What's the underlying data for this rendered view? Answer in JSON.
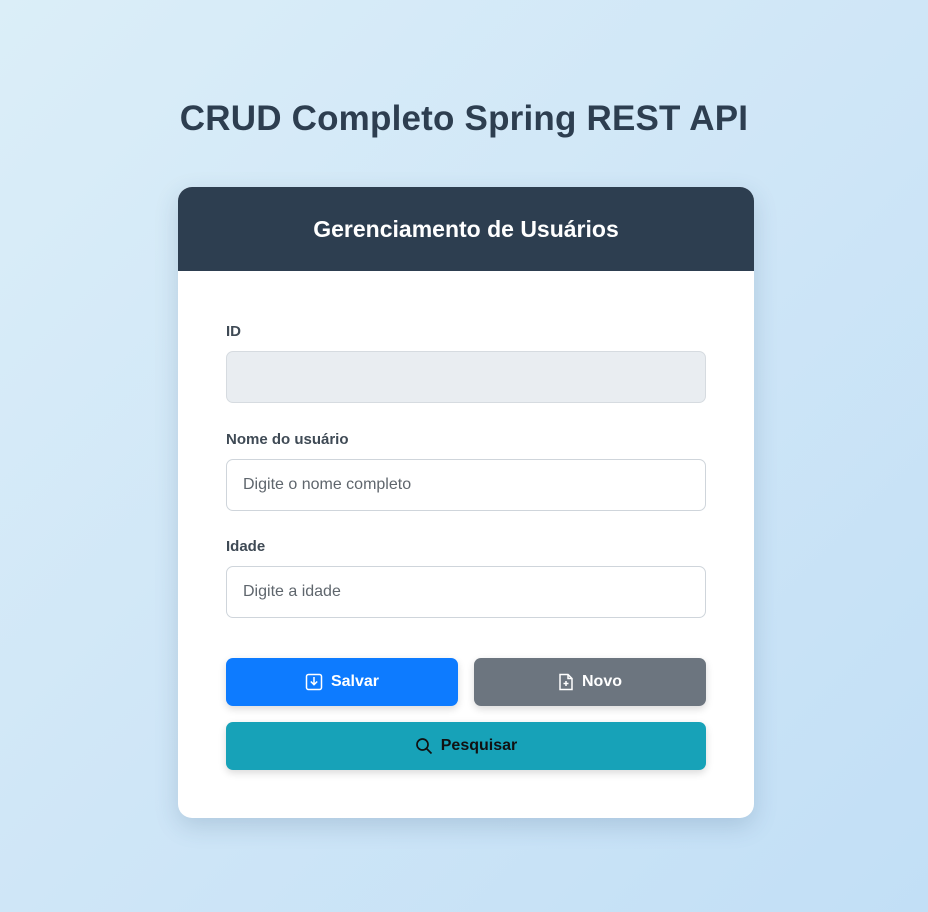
{
  "page": {
    "title": "CRUD Completo Spring REST API"
  },
  "card": {
    "header_title": "Gerenciamento de Usuários"
  },
  "form": {
    "id": {
      "label": "ID",
      "value": "",
      "placeholder": ""
    },
    "name": {
      "label": "Nome do usuário",
      "value": "",
      "placeholder": "Digite o nome completo"
    },
    "age": {
      "label": "Idade",
      "value": "",
      "placeholder": "Digite a idade"
    }
  },
  "buttons": {
    "save": {
      "label": "Salvar",
      "icon": "save-icon"
    },
    "new": {
      "label": "Novo",
      "icon": "new-file-icon"
    },
    "search": {
      "label": "Pesquisar",
      "icon": "search-icon"
    }
  },
  "colors": {
    "header_bg": "#2d3e50",
    "primary": "#0d7bff",
    "secondary": "#6c757f",
    "info": "#17a2b8"
  }
}
